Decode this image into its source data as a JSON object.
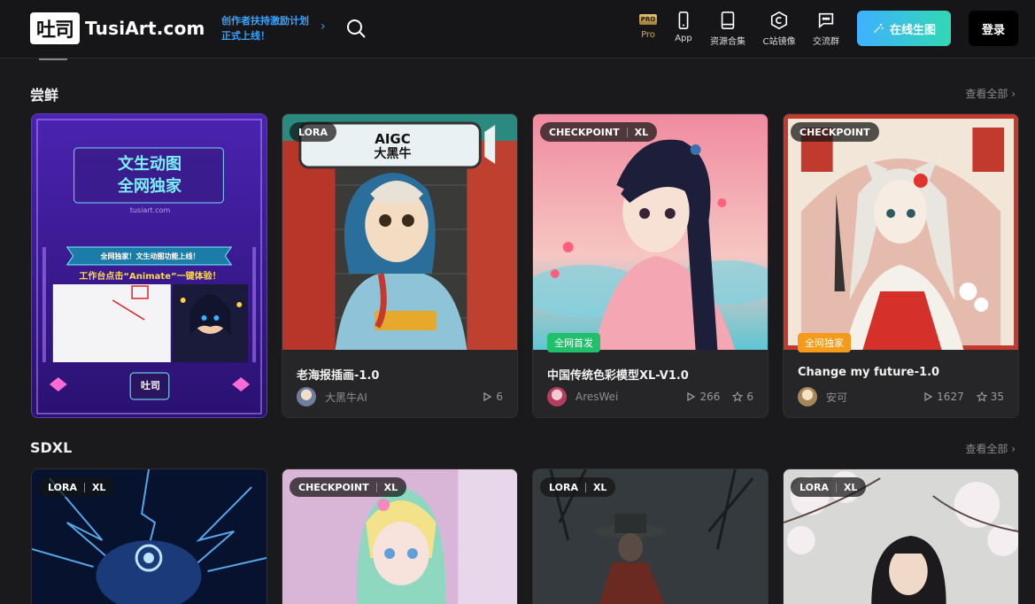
{
  "header": {
    "logo_mark": "吐司",
    "logo_text": "TusiArt.com",
    "promo_line1": "创作者扶持激励计划",
    "promo_line2": "正式上线！",
    "nav": [
      {
        "label": "Pro",
        "icon": "pro-icon"
      },
      {
        "label": "App",
        "icon": "phone-icon"
      },
      {
        "label": "资源合集",
        "icon": "book-icon"
      },
      {
        "label": "C站镜像",
        "icon": "hexagon-icon"
      },
      {
        "label": "交流群",
        "icon": "chat-icon"
      }
    ],
    "pro_badge": "PRO",
    "create_label": "在线生图",
    "login_label": "登录"
  },
  "sections": [
    {
      "title": "尝鲜",
      "see_all": "查看全部 ›",
      "cards": [
        {
          "banner_title1": "文生动图",
          "banner_title2": "全网独家",
          "banner_site": "tusiart.com",
          "banner_ribbon": "全网独家！文生动图功能上线！",
          "banner_text": "工作台点击“Animate”一键体验！",
          "banner_logo": "吐司"
        },
        {
          "tags": [
            "LORA"
          ],
          "img_text1": "AIGC",
          "img_text2": "大黑牛",
          "title": "老海报插画-1.0",
          "author": "大黑牛AI",
          "runs": "6"
        },
        {
          "tags": [
            "CHECKPOINT",
            "XL"
          ],
          "badge": "全网首发",
          "title": "中国传统色彩模型XL-V1.0",
          "author": "AresWei",
          "runs": "266",
          "stars": "6"
        },
        {
          "tags": [
            "CHECKPOINT"
          ],
          "badge": "全网独家",
          "title": "Change my future-1.0",
          "author": "安可",
          "runs": "1627",
          "stars": "35"
        }
      ]
    },
    {
      "title": "SDXL",
      "see_all": "查看全部 ›",
      "cards": [
        {
          "tags": [
            "LORA",
            "XL"
          ]
        },
        {
          "tags": [
            "CHECKPOINT",
            "XL"
          ]
        },
        {
          "tags": [
            "LORA",
            "XL"
          ]
        },
        {
          "tags": [
            "LORA",
            "XL"
          ]
        }
      ]
    }
  ],
  "colors": {
    "accent_blue": "#36a3ff",
    "badge_green": "#1fbf6b",
    "badge_orange": "#f59a1b"
  }
}
